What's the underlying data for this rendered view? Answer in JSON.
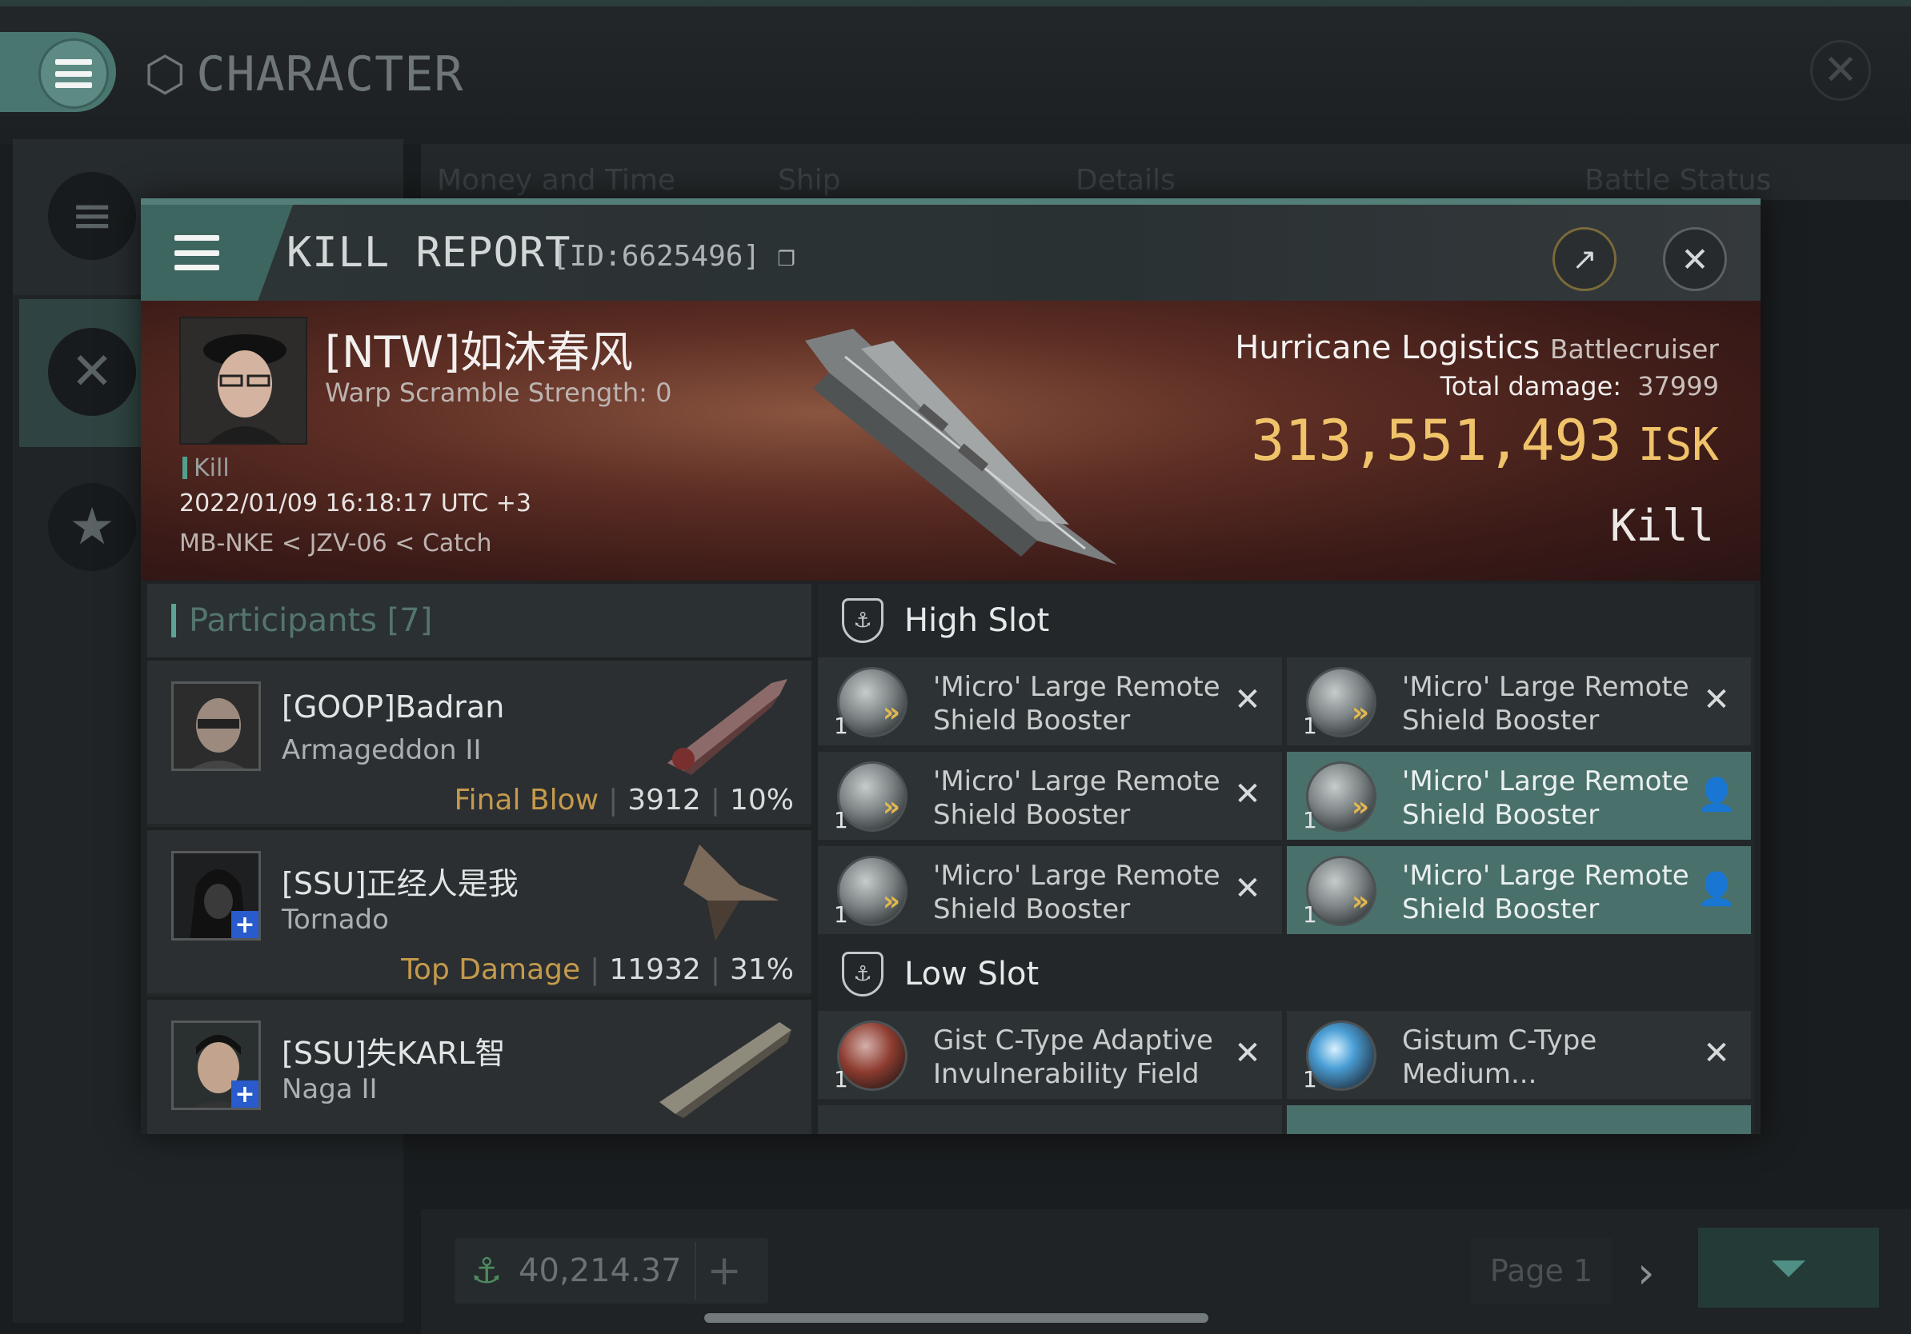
{
  "app": {
    "title": "CHARACTER",
    "bg_tabs": [
      "Money and Time",
      "Ship",
      "Details",
      "Battle Status"
    ],
    "bottom": {
      "isk": "40,214.37",
      "page": "Page 1"
    }
  },
  "report": {
    "title": "KILL REPORT",
    "id": "[ID:6625496]",
    "victim": {
      "name": "[NTW]如沐春风",
      "sub": "Warp Scramble Strength: 0",
      "tag": "Kill",
      "datetime": "2022/01/09 16:18:17 UTC +3",
      "location": "MB-NKE < JZV-06 < Catch",
      "ship": "Hurricane Logistics",
      "ship_class": "Battlecruiser",
      "total_damage_label": "Total damage:",
      "total_damage": "37999",
      "isk": "313,551,493",
      "isk_unit": "ISK",
      "outcome": "Kill"
    },
    "participants": {
      "header": "Participants [7]",
      "rows": [
        {
          "name": "[GOOP]Badran",
          "ship": "Armageddon II",
          "label": "Final Blow",
          "damage": "3912",
          "pct": "10%"
        },
        {
          "name": "[SSU]正经人是我",
          "ship": "Tornado",
          "label": "Top Damage",
          "damage": "11932",
          "pct": "31%"
        },
        {
          "name": "[SSU]失KARL智",
          "ship": "Naga II",
          "label": "",
          "damage": "",
          "pct": ""
        }
      ]
    },
    "slots": {
      "high_label": "High Slot",
      "low_label": "Low Slot",
      "high": [
        {
          "name": "'Micro' Large Remote Shield Booster",
          "qty": "1"
        },
        {
          "name": "'Micro' Large Remote Shield Booster",
          "qty": "1"
        },
        {
          "name": "'Micro' Large Remote Shield Booster",
          "qty": "1"
        },
        {
          "name": "'Micro' Large Remote Shield Booster",
          "qty": "1"
        },
        {
          "name": "'Micro' Large Remote Shield Booster",
          "qty": "1"
        },
        {
          "name": "'Micro' Large Remote Shield Booster",
          "qty": "1"
        }
      ],
      "low": [
        {
          "name": "Gist C-Type Adaptive Invulnerability Field",
          "qty": "1"
        },
        {
          "name": "Gistum C-Type Medium...",
          "qty": "1"
        }
      ]
    }
  },
  "colors": {
    "accent": "#4a7670",
    "isk": "#f0c36a",
    "label_gold": "#c59a4c",
    "ready_slot": "#4a706b"
  }
}
